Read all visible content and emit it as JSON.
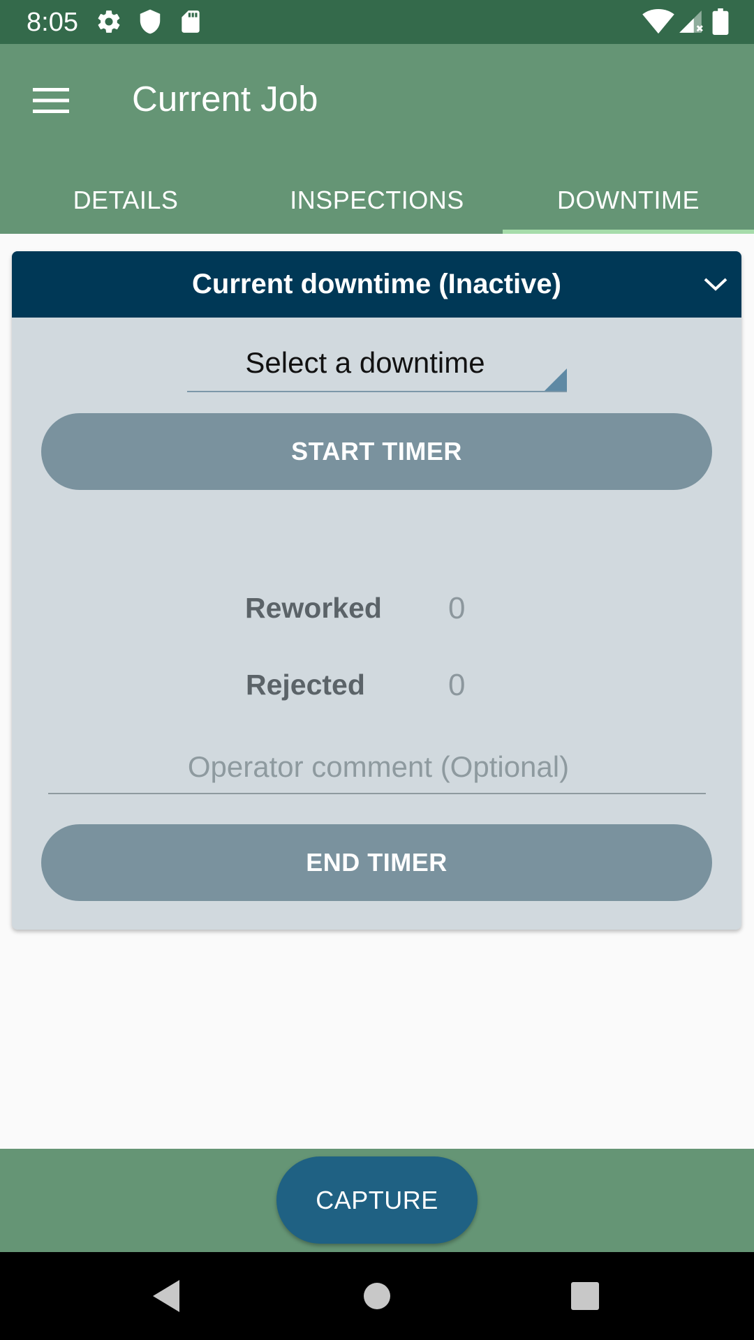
{
  "status_bar": {
    "time": "8:05",
    "icons": [
      "gear-icon",
      "shield-icon",
      "sd-card-icon",
      "wifi-icon",
      "signal-icon",
      "battery-icon"
    ]
  },
  "app_bar": {
    "title": "Current Job",
    "menu_icon": "hamburger-menu-icon",
    "tabs": [
      {
        "label": "DETAILS",
        "selected": false
      },
      {
        "label": "INSPECTIONS",
        "selected": false
      },
      {
        "label": "DOWNTIME",
        "selected": true
      }
    ]
  },
  "downtime_card": {
    "title": "Current downtime (Inactive)",
    "collapse_icon": "chevron-down-icon",
    "select": {
      "value": "Select a downtime"
    },
    "start_button": "START TIMER",
    "stats": [
      {
        "label": "Reworked",
        "value": "0"
      },
      {
        "label": "Rejected",
        "value": "0"
      }
    ],
    "comment": {
      "placeholder": "Operator comment (Optional)",
      "value": ""
    },
    "end_button": "END TIMER"
  },
  "bottom_bar": {
    "capture_button": "CAPTURE"
  },
  "nav_bar": {
    "icons": [
      "back-icon",
      "home-icon",
      "recents-icon"
    ]
  },
  "colors": {
    "status_bar": "#346a4b",
    "app_bar": "#659575",
    "tab_indicator": "#a6dcaa",
    "card_header": "#003856",
    "card_body": "#d1d9de",
    "pill_button": "#7a929e",
    "capture_button": "#1f6183"
  }
}
